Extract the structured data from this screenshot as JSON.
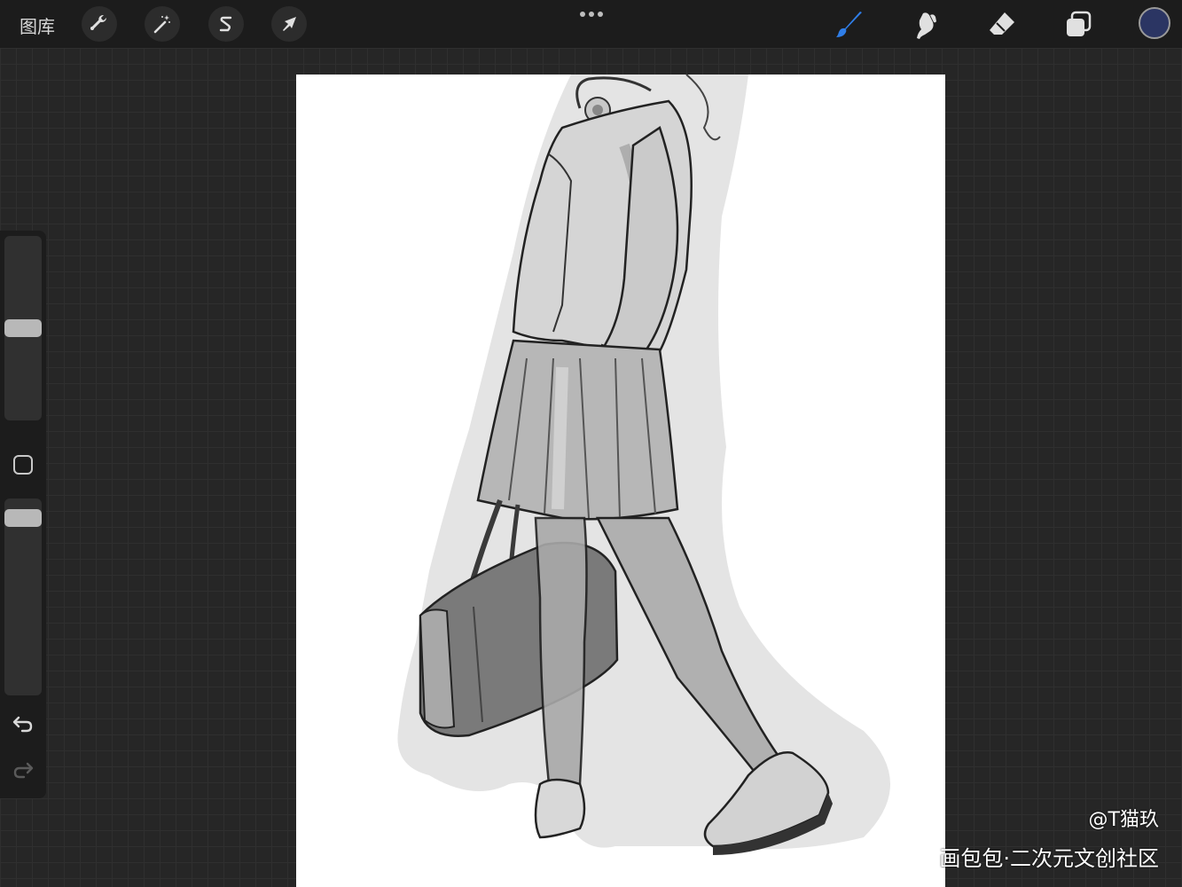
{
  "toolbar": {
    "gallery_label": "图库",
    "tools": [
      {
        "name": "actions",
        "icon": "wrench-icon"
      },
      {
        "name": "adjustments",
        "icon": "magic-wand-icon"
      },
      {
        "name": "selection",
        "icon": "selection-s-icon"
      },
      {
        "name": "transform",
        "icon": "arrow-cursor-icon"
      }
    ],
    "more_icon": "ellipsis-icon",
    "right_tools": [
      {
        "name": "brush",
        "icon": "brush-icon",
        "active": true
      },
      {
        "name": "smudge",
        "icon": "smudge-icon",
        "active": false
      },
      {
        "name": "eraser",
        "icon": "eraser-icon",
        "active": false
      },
      {
        "name": "layers",
        "icon": "layers-icon",
        "active": false
      }
    ],
    "current_color": "#2b3563",
    "active_accent": "#2f7ee8"
  },
  "sidebar": {
    "brush_size_level": 0.5,
    "opacity_level": 0.94,
    "undo_icon": "undo-icon",
    "redo_icon": "redo-icon",
    "modify_icon": "square-icon"
  },
  "canvas": {
    "artwork": "grayscale sketch of a student in school uniform walking with a bag"
  },
  "watermark": {
    "user": "@T猫玖",
    "site": "画包包·二次元文创社区"
  }
}
